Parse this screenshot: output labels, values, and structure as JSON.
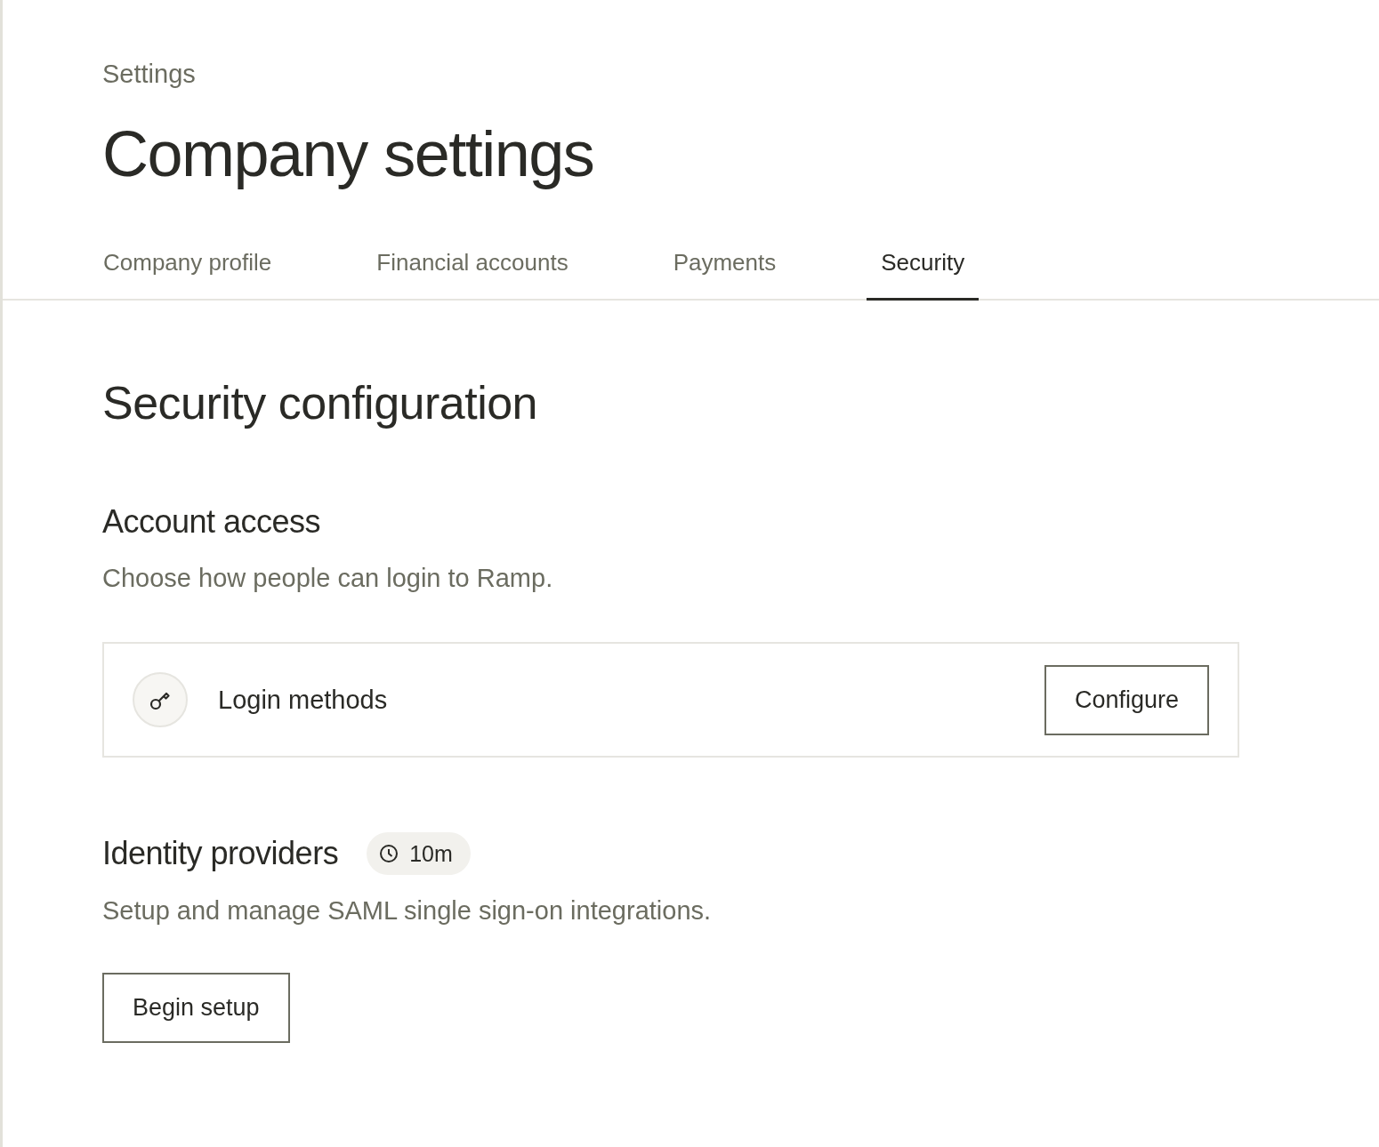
{
  "breadcrumb": "Settings",
  "title": "Company settings",
  "tabs": [
    {
      "label": "Company profile",
      "selected": false
    },
    {
      "label": "Financial accounts",
      "selected": false
    },
    {
      "label": "Payments",
      "selected": false
    },
    {
      "label": "Security",
      "selected": true
    }
  ],
  "section_title": "Security configuration",
  "account_access": {
    "heading": "Account access",
    "description": "Choose how people can login to Ramp.",
    "card": {
      "label": "Login methods",
      "button": "Configure"
    }
  },
  "identity_providers": {
    "heading": "Identity providers",
    "badge": "10m",
    "description": "Setup and manage SAML single sign-on integrations.",
    "button": "Begin setup"
  }
}
